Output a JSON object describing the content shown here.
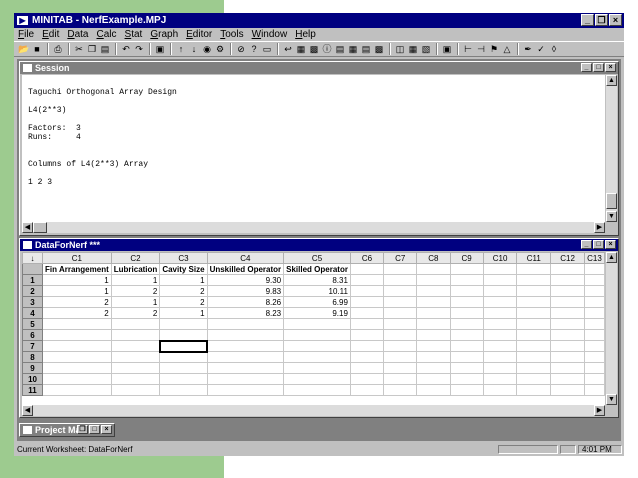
{
  "app": {
    "title": "MINITAB - NerfExample.MPJ"
  },
  "menubar": [
    "File",
    "Edit",
    "Data",
    "Calc",
    "Stat",
    "Graph",
    "Editor",
    "Tools",
    "Window",
    "Help"
  ],
  "toolbar_icons": [
    "open-icon",
    "save-icon",
    "print-icon",
    "cut-icon",
    "copy-icon",
    "paste-icon",
    "undo-icon",
    "redo-icon",
    "edit-last-dialog-icon",
    "prev-icon",
    "next-icon",
    "find-icon",
    "replace-icon",
    "cancel-icon",
    "help-icon",
    "stop-icon",
    "session-icon",
    "data-icon",
    "project-manager-icon",
    "info-icon",
    "history-icon",
    "graphs-icon",
    "report-pad-icon",
    "related-docs-icon",
    "worksheet-icon",
    "design-icon",
    "brush-icon",
    "row-icon",
    "cols-icon",
    "update-icon",
    "tag-icon",
    "eraser-icon"
  ],
  "session": {
    "title": "Session",
    "lines": [
      "",
      "Taguchi Orthogonal Array Design",
      "",
      "L4(2**3)",
      "",
      "Factors:  3",
      "Runs:     4",
      "",
      "",
      "Columns of L4(2**3) Array",
      "",
      "1 2 3"
    ]
  },
  "worksheet": {
    "title": "DataForNerf ***",
    "corner": "↓",
    "columns": [
      "C1",
      "C2",
      "C3",
      "C4",
      "C5",
      "C6",
      "C7",
      "C8",
      "C9",
      "C10",
      "C11",
      "C12",
      "C13"
    ],
    "names": [
      "Fin Arrangement",
      "Lubrication",
      "Cavity Size",
      "Unskilled Operator",
      "Skilled Operator",
      "",
      "",
      "",
      "",
      "",
      "",
      "",
      ""
    ],
    "rows": [
      {
        "n": "1",
        "cells": [
          "1",
          "1",
          "1",
          "9.30",
          "8.31"
        ]
      },
      {
        "n": "2",
        "cells": [
          "1",
          "2",
          "2",
          "9.83",
          "10.11"
        ]
      },
      {
        "n": "3",
        "cells": [
          "2",
          "1",
          "2",
          "8.26",
          "6.99"
        ]
      },
      {
        "n": "4",
        "cells": [
          "2",
          "2",
          "1",
          "8.23",
          "9.19"
        ]
      },
      {
        "n": "5",
        "cells": []
      },
      {
        "n": "6",
        "cells": []
      },
      {
        "n": "7",
        "cells": []
      },
      {
        "n": "8",
        "cells": []
      },
      {
        "n": "9",
        "cells": []
      },
      {
        "n": "10",
        "cells": []
      },
      {
        "n": "11",
        "cells": []
      }
    ]
  },
  "project_manager": {
    "title": "Project Man..."
  },
  "status": {
    "text": "Current Worksheet: DataForNerf",
    "time": "4:01 PM"
  }
}
